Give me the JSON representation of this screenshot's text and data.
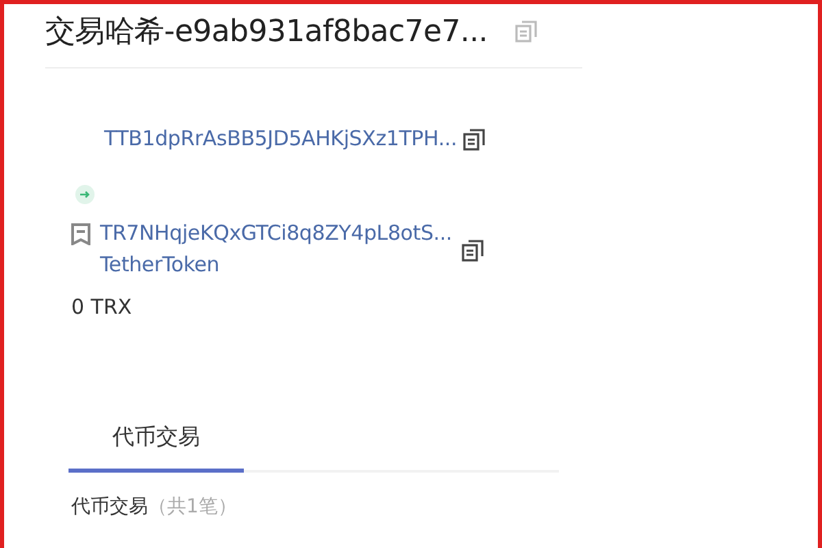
{
  "title": "交易哈希-e9ab931af8bac7e7...",
  "from": {
    "address": "TTB1dpRrAsBB5JD5AHKjSXz1TPH..."
  },
  "to": {
    "address": "TR7NHqjeKQxGTCi8q8ZY4pL8otS...",
    "name": "TetherToken"
  },
  "amount": "0 TRX",
  "tabs": [
    {
      "label": "代币交易",
      "selected": true
    }
  ],
  "section": {
    "heading": "代币交易",
    "count": "（共1笔）"
  }
}
